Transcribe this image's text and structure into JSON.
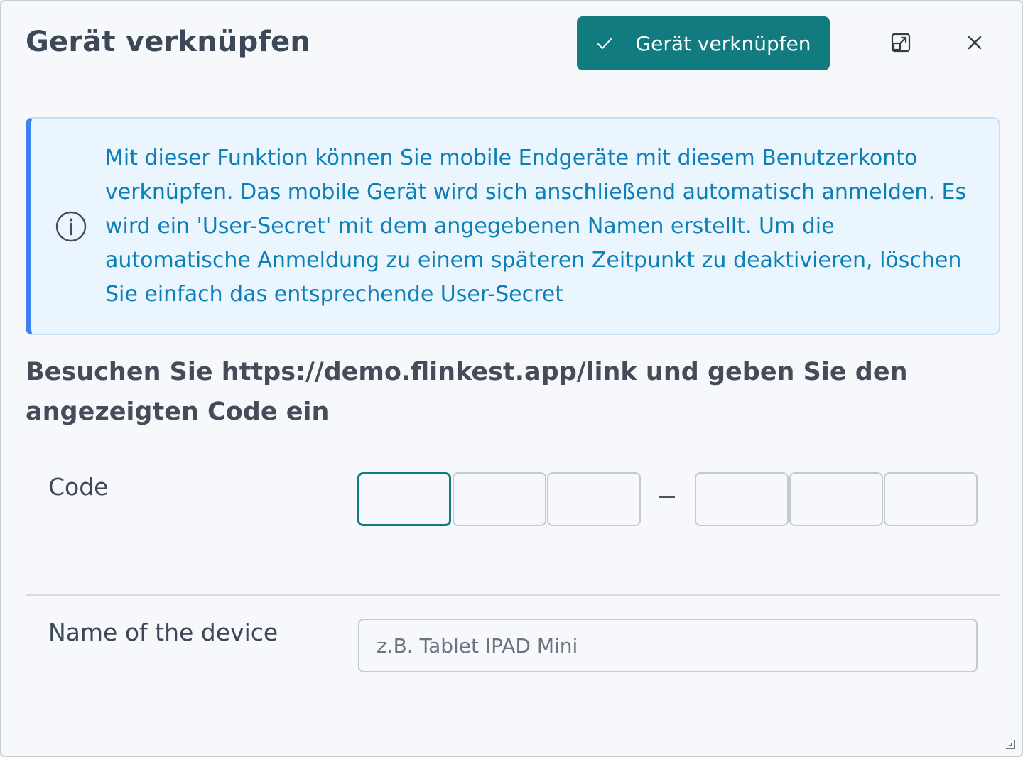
{
  "dialog": {
    "title": "Gerät verknüpfen",
    "primary_button_label": "Gerät verknüpfen"
  },
  "info": {
    "text": "Mit dieser Funktion können Sie mobile Endgeräte mit diesem Benutzerkonto verknüpfen. Das mobile Gerät wird sich anschließend automatisch anmelden. Es wird ein 'User-Secret' mit dem angegebenen Namen erstellt. Um die automatische Anmeldung zu einem späteren Zeitpunkt zu deaktivieren, löschen Sie einfach das entsprechende User-Secret"
  },
  "instruction": "Besuchen Sie https://demo.flinkest.app/link und geben Sie den angezeigten Code ein",
  "code": {
    "label": "Code",
    "values": [
      "",
      "",
      "",
      "",
      "",
      ""
    ]
  },
  "device": {
    "label": "Name of the device",
    "placeholder": "z.B. Tablet IPAD Mini",
    "value": ""
  },
  "colors": {
    "accent": "#117b7f",
    "info_border": "#3b82f6",
    "info_text": "#0b7fb8"
  }
}
